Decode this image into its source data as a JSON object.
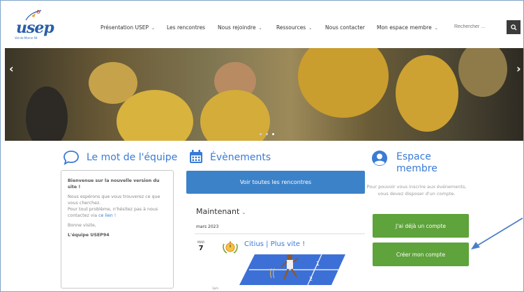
{
  "header": {
    "logo_text": "usep",
    "logo_tagline": "Val-de-Marne 94",
    "nav": [
      {
        "label": "Présentation USEP",
        "has_dropdown": true
      },
      {
        "label": "Les rencontres",
        "has_dropdown": false
      },
      {
        "label": "Nous rejoindre",
        "has_dropdown": true
      },
      {
        "label": "Ressources",
        "has_dropdown": true
      },
      {
        "label": "Nous contacter",
        "has_dropdown": false
      },
      {
        "label": "Mon espace membre",
        "has_dropdown": true
      }
    ],
    "search_placeholder": "Rechercher ..."
  },
  "hero": {
    "slide_count": 3,
    "active_slide": 3
  },
  "team": {
    "title": "Le mot de l'équipe",
    "welcome": "Bienvenue sur la nouvelle version du site !",
    "line1": "Nous espérons que vous trouverez ce que vous cherchez.",
    "line2_prefix": "Pour tout problème, n'hésitez pas à nous contactez via ",
    "line2_link": "ce lien",
    "line2_suffix": " !",
    "greeting": "Bonne visite,",
    "signature": "L'équipe USEP94"
  },
  "events": {
    "title": "Évènements",
    "all_button": "Voir toutes les rencontres",
    "period": "Maintenant",
    "month": "mars 2023",
    "event": {
      "weekday": "MAR",
      "day": "7",
      "title": "Citius | Plus vite !",
      "time_text": "1pm"
    }
  },
  "member": {
    "title_line1": "Espace",
    "title_line2": "membre",
    "text": "Pour pouvoir vous inscrire aux événements, vous devez disposer d'un compte.",
    "login_button": "J'ai déjà un compte",
    "create_button": "Créer mon compte"
  },
  "colors": {
    "accent_blue": "#3a7bd5",
    "button_blue": "#3c82c8",
    "button_green": "#5ea33b",
    "annotation_arrow": "#4a7fc8"
  }
}
